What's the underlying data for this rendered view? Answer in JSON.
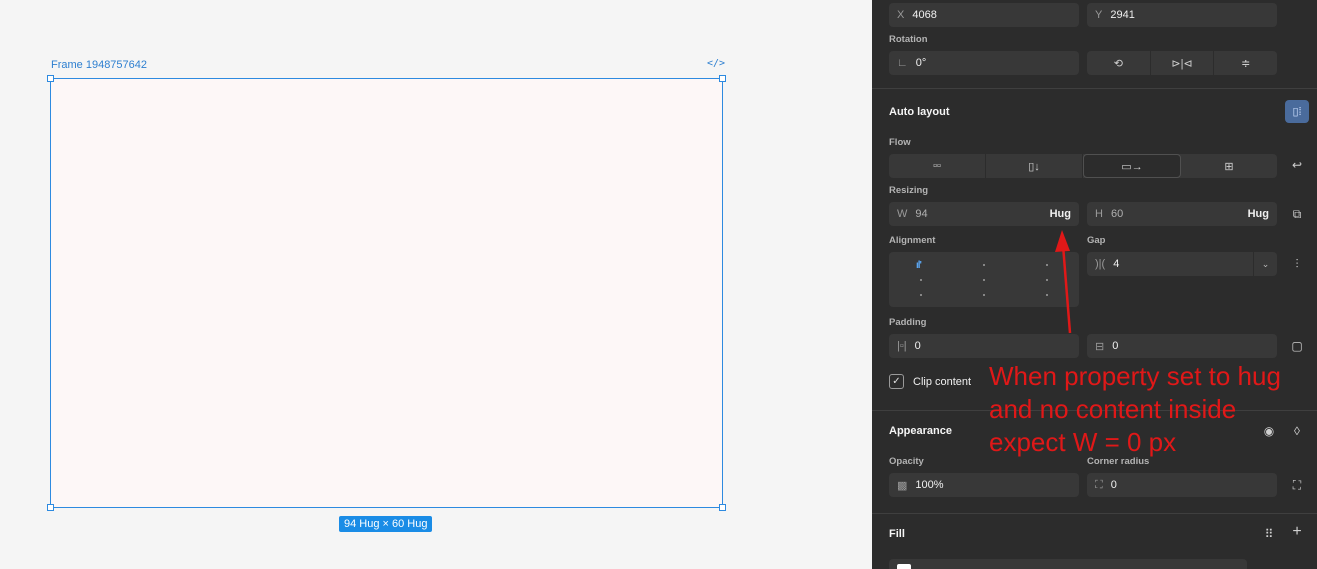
{
  "canvas": {
    "frame_name": "Frame 1948757642",
    "code_icon": "</>",
    "size_badge": "94 Hug × 60 Hug",
    "frame_fill": "#fdf7f7",
    "selection_color": "#2d8ae0"
  },
  "panel": {
    "position": {
      "x_label": "X",
      "x_value": "4068",
      "y_label": "Y",
      "y_value": "2941"
    },
    "rotation": {
      "label": "Rotation",
      "value": "0°",
      "icons": [
        "rotate-icon",
        "flip-horizontal-icon",
        "flip-vertical-icon"
      ]
    },
    "auto_layout": {
      "title": "Auto layout",
      "flow_label": "Flow",
      "flow_options": [
        "freeform-icon",
        "vertical-icon",
        "horizontal-icon",
        "grid-icon"
      ],
      "flow_active_index": 2,
      "resizing_label": "Resizing",
      "width": {
        "label": "W",
        "value": "94",
        "mode": "Hug"
      },
      "height": {
        "label": "H",
        "value": "60",
        "mode": "Hug"
      },
      "alignment_label": "Alignment",
      "gap_label": "Gap",
      "gap_value": "4",
      "padding_label": "Padding",
      "padding_horizontal": "0",
      "padding_vertical": "0",
      "clip_content_label": "Clip content",
      "clip_content_checked": true
    },
    "appearance": {
      "title": "Appearance",
      "opacity_label": "Opacity",
      "opacity_value": "100%",
      "corner_radius_label": "Corner radius",
      "corner_radius_value": "0"
    },
    "fill": {
      "title": "Fill"
    }
  },
  "annotation": {
    "text": "When property set to hug\nand no content inside\nexpect W = 0 px",
    "color": "#e01818"
  }
}
